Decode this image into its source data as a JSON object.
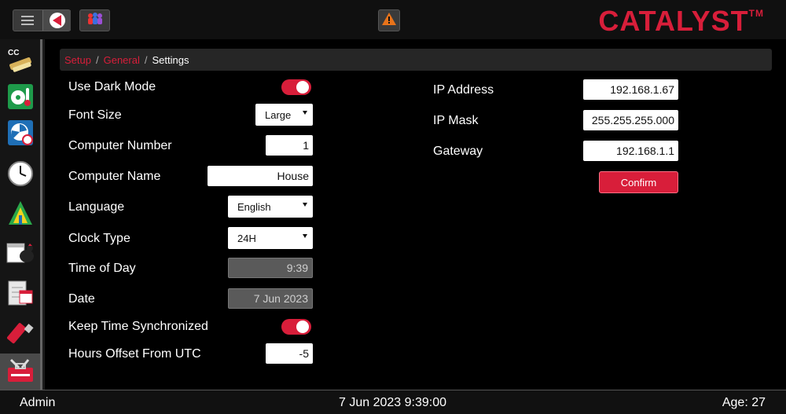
{
  "header": {
    "brand": "CATALYST",
    "trademark": "TM",
    "icons": [
      "hamburger-menu-icon",
      "back-arrow-icon",
      "users-icon",
      "warning-icon"
    ],
    "accent_color": "#d81e3a"
  },
  "sidebar": {
    "items": [
      {
        "name": "cc-calibration",
        "label": "CC",
        "active": false
      },
      {
        "name": "ventilation-temperature",
        "active": false
      },
      {
        "name": "fan-timer",
        "active": false
      },
      {
        "name": "clock",
        "active": false
      },
      {
        "name": "lighting",
        "active": false
      },
      {
        "name": "bird-count",
        "active": false
      },
      {
        "name": "calendar-log",
        "active": false
      },
      {
        "name": "usb-drive",
        "active": false
      },
      {
        "name": "setup-tools",
        "active": true
      }
    ]
  },
  "breadcrumb": {
    "items": [
      "Setup",
      "General",
      "Settings"
    ],
    "separator": "/"
  },
  "settings": {
    "dark_mode": {
      "label": "Use Dark Mode",
      "on": true
    },
    "font_size": {
      "label": "Font Size",
      "value": "Large"
    },
    "computer_number": {
      "label": "Computer Number",
      "value": "1"
    },
    "computer_name": {
      "label": "Computer Name",
      "value": "House"
    },
    "language": {
      "label": "Language",
      "value": "English"
    },
    "clock_type": {
      "label": "Clock Type",
      "value": "24H"
    },
    "time_of_day": {
      "label": "Time of Day",
      "value": "9:39"
    },
    "date": {
      "label": "Date",
      "value": "7 Jun 2023"
    },
    "keep_time_sync": {
      "label": "Keep Time Synchronized",
      "on": true
    },
    "utc_offset": {
      "label": "Hours Offset From UTC",
      "value": "-5"
    }
  },
  "network": {
    "ip_address": {
      "label": "IP Address",
      "value": "192.168.1.67"
    },
    "ip_mask": {
      "label": "IP Mask",
      "value": "255.255.255.000"
    },
    "gateway": {
      "label": "Gateway",
      "value": "192.168.1.1"
    },
    "confirm_label": "Confirm"
  },
  "status": {
    "user": "Admin",
    "datetime": "7 Jun 2023 9:39:00",
    "age": "Age: 27"
  }
}
